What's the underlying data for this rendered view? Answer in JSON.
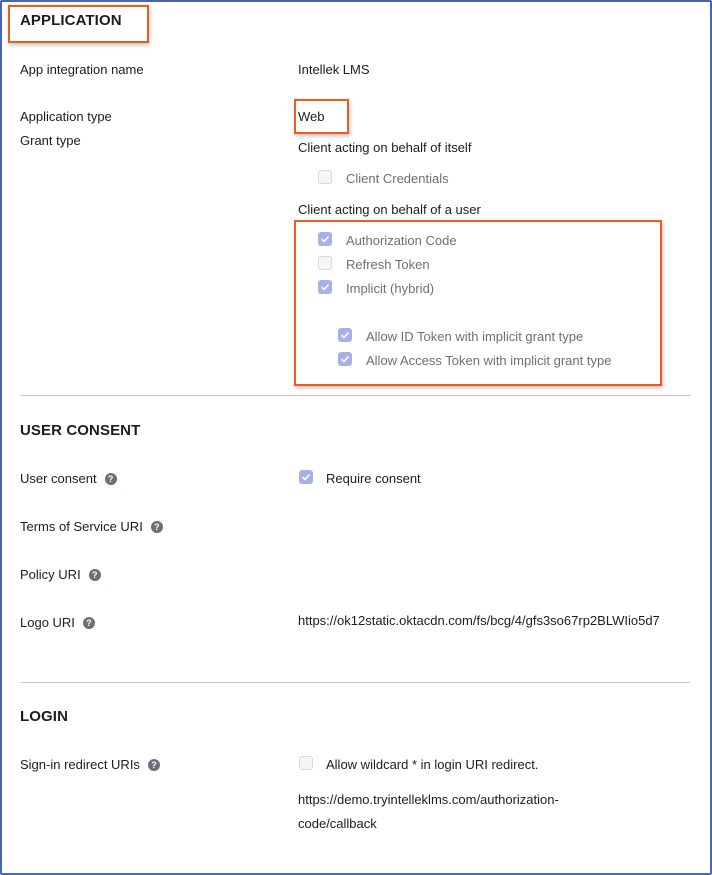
{
  "application": {
    "heading": "APPLICATION",
    "fields": {
      "app_integration_name": {
        "label": "App integration name",
        "value": "Intellek LMS"
      },
      "application_type": {
        "label": "Application type",
        "value": "Web"
      },
      "grant_type": {
        "label": "Grant type",
        "self_group_label": "Client acting on behalf of itself",
        "self_options": [
          {
            "label": "Client Credentials",
            "checked": false
          }
        ],
        "user_group_label": "Client acting on behalf of a user",
        "user_options": [
          {
            "label": "Authorization Code",
            "checked": true
          },
          {
            "label": "Refresh Token",
            "checked": false
          },
          {
            "label": "Implicit (hybrid)",
            "checked": true
          }
        ],
        "implicit_sub_options": [
          {
            "label": "Allow ID Token with implicit grant type",
            "checked": true
          },
          {
            "label": "Allow Access Token with implicit grant type",
            "checked": true
          }
        ]
      }
    }
  },
  "user_consent": {
    "heading": "USER CONSENT",
    "fields": {
      "user_consent": {
        "label": "User consent",
        "option": {
          "label": "Require consent",
          "checked": true
        }
      },
      "terms_of_service_uri": {
        "label": "Terms of Service URI",
        "value": ""
      },
      "policy_uri": {
        "label": "Policy URI",
        "value": ""
      },
      "logo_uri": {
        "label": "Logo URI",
        "value": "https://ok12static.oktacdn.com/fs/bcg/4/gfs3so67rp2BLWIio5d7"
      }
    }
  },
  "login": {
    "heading": "LOGIN",
    "fields": {
      "sign_in_redirect_uris": {
        "label": "Sign-in redirect URIs",
        "option": {
          "label": "Allow wildcard * in login URI redirect.",
          "checked": false
        },
        "value": "https://demo.tryintelleklms.com/authorization-code/callback"
      }
    }
  },
  "icons": {
    "help": "?"
  },
  "colors": {
    "highlight": "#f05a1a",
    "checkbox_checked": "#a7b1e8",
    "frame_border": "#4a64b8"
  }
}
